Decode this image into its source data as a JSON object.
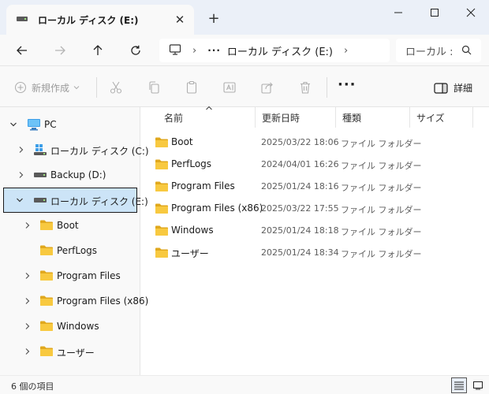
{
  "window": {
    "tab_title": "ローカル ディスク (E:)",
    "tab_close": "✕",
    "new_tab": "+"
  },
  "address": {
    "overflow": "···",
    "separator": "›",
    "crumb": "ローカル ディスク (E:)",
    "search_text": "ローカル :"
  },
  "commands": {
    "new_label": "新規作成",
    "more": "···",
    "details_label": "詳細"
  },
  "nav": {
    "items": [
      {
        "label": "PC"
      },
      {
        "label": "ローカル ディスク (C:)"
      },
      {
        "label": "Backup (D:)"
      },
      {
        "label": "ローカル ディスク (E:)"
      },
      {
        "label": "Boot"
      },
      {
        "label": "PerfLogs"
      },
      {
        "label": "Program Files"
      },
      {
        "label": "Program Files (x86)"
      },
      {
        "label": "Windows"
      },
      {
        "label": "ユーザー"
      }
    ]
  },
  "columns": {
    "name": "名前",
    "modified": "更新日時",
    "type": "種類",
    "size": "サイズ"
  },
  "files": [
    {
      "name": "Boot",
      "date": "2025/03/22 18:06",
      "type": "ファイル フォルダー"
    },
    {
      "name": "PerfLogs",
      "date": "2024/04/01 16:26",
      "type": "ファイル フォルダー"
    },
    {
      "name": "Program Files",
      "date": "2025/01/24 18:16",
      "type": "ファイル フォルダー"
    },
    {
      "name": "Program Files (x86)",
      "date": "2025/03/22 17:55",
      "type": "ファイル フォルダー"
    },
    {
      "name": "Windows",
      "date": "2025/01/24 18:18",
      "type": "ファイル フォルダー"
    },
    {
      "name": "ユーザー",
      "date": "2025/01/24 18:34",
      "type": "ファイル フォルダー"
    }
  ],
  "status": {
    "item_count": "6 個の項目"
  },
  "colors": {
    "accent": "#0067c0",
    "selection": "#cce4f7",
    "folder": "#f8c940",
    "folder_dark": "#e0a81e"
  }
}
